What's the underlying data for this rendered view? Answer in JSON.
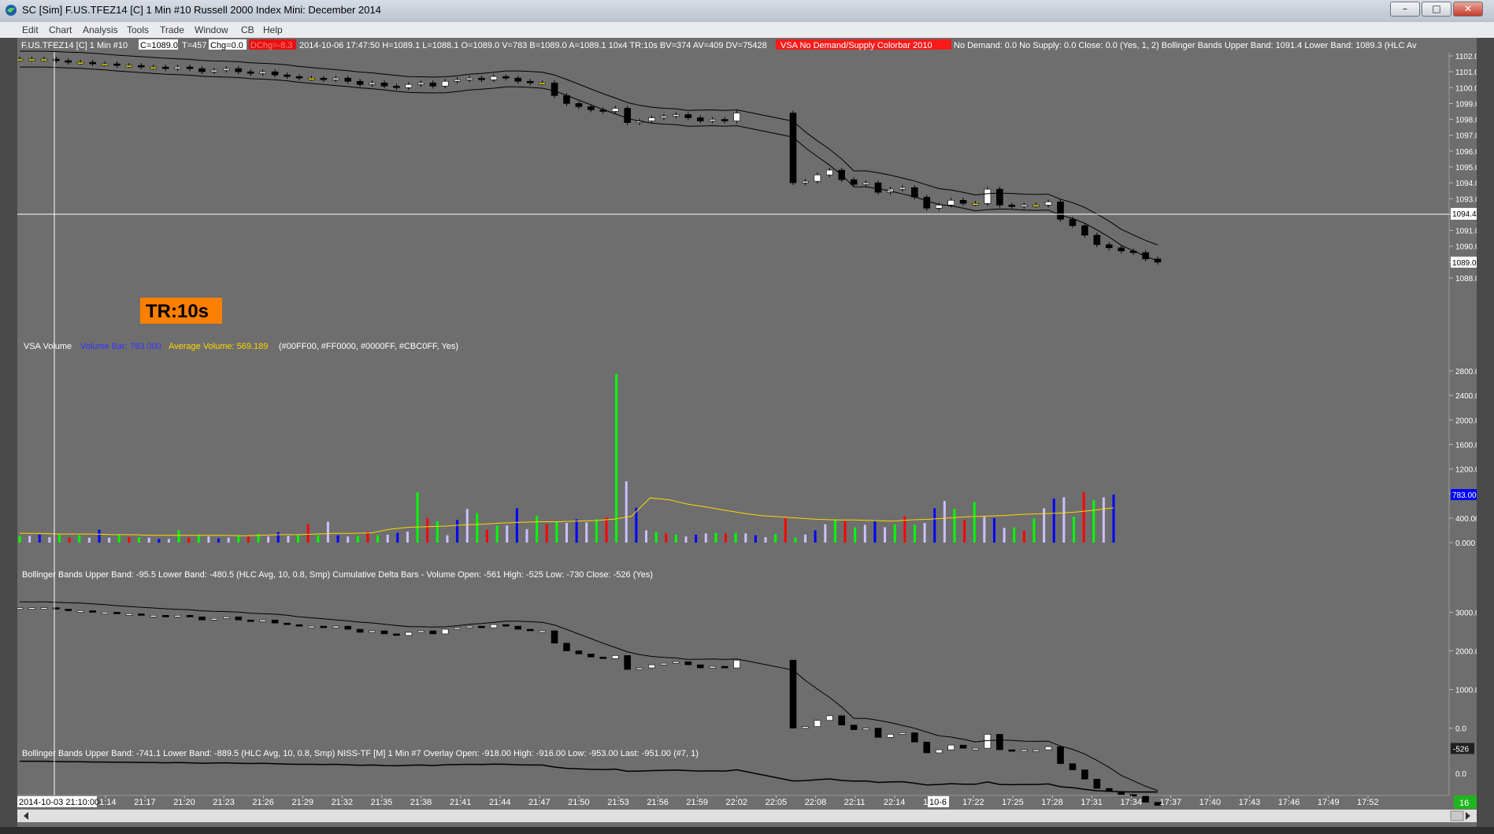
{
  "window": {
    "title": "SC [Sim] F.US.TFEZ14 [C]  1 Min   #10  Russell 2000 Index Mini: December 2014",
    "controls": {
      "minimize": "–",
      "maximize": "□",
      "close": "✕"
    }
  },
  "menu": [
    "Edit",
    "Chart",
    "Analysis",
    "Tools",
    "Trade",
    "Window",
    "CB",
    "Help"
  ],
  "colors": {
    "background": "#6e6e6e",
    "up_bar": "#00FF00",
    "down_bar": "#FF0000",
    "neutral_bar": "#0000FF",
    "low_volume_bar": "#CBC0FF",
    "average_line": "#FFD700",
    "tr_label_bg": "#FF8000",
    "vsa_flag_bg": "#FF0000"
  },
  "header": {
    "symbol": "F.US.TFEZ14 [C]  1 Min   #10",
    "c_box": "C=1089.0",
    "t": "T=457",
    "chg_box": "Chg=0.0",
    "dchg_box": "DChg=-8.3",
    "info": "2014-10-06 17:47:50  H=1089.1  L=1088.1  O=1089.0  V=783  B=1089.0  A=1089.1  10x4  TR:10s  BV=374  AV=409  DV=75428",
    "vsa_flag": "VSA No Demand/Supply Colorbar 2010",
    "vsa_values": "No Demand: 0.0   No Supply: 0.0   Close: 0.0   (Yes, 1, 2)   Bollinger Bands   Upper Band: 1091.4   Lower Band: 1089.3   (HLC Av"
  },
  "tr_label": "TR:10s",
  "crosshair": {
    "price_label": "1094.4",
    "date_label": "2014-10-03  21:10:00"
  },
  "volume_panel": {
    "title": "VSA Volume",
    "volume_bar": "Volume Bar: 783.000",
    "average_volume": "Average Volume: 569.189",
    "params": "(#00FF00, #FF0000, #0000FF, #CBC0FF, Yes)",
    "current_label": "783.000"
  },
  "delta_panel": {
    "legend": "Bollinger Bands   Upper Band: -95.5   Lower Band: -480.5   (HLC Avg, 10, 0.8, Smp)   Cumulative Delta Bars - Volume   Open: -561   High: -525   Low: -730   Close: -526   (Yes)",
    "current_label": "-526"
  },
  "niss_panel": {
    "legend": "Bollinger Bands   Upper Band: -741.1   Lower Band: -889.5   (HLC Avg, 10, 0.8, Smp)   NISS-TF [M]  1 Min   #7 Overlay   Open: -918.00   High: -916.00   Low: -953.00   Last: -951.00   (#7, 1)"
  },
  "time_axis_badge": "10-6",
  "corner_badge": "16",
  "chart_data": [
    {
      "type": "candlestick",
      "title": "Russell 2000 Index Mini: December 2014",
      "ylim": [
        1088.0,
        1102.0
      ],
      "y_ticks": [
        1102.0,
        1101.0,
        1100.0,
        1099.0,
        1098.0,
        1097.0,
        1096.0,
        1095.0,
        1094.0,
        1093.0,
        1092.0,
        1091.0,
        1090.0,
        1089.0,
        1088.0
      ],
      "current_price": 1089.0,
      "x_ticks": [
        "21:14",
        "21:17",
        "21:20",
        "21:23",
        "21:26",
        "21:29",
        "21:32",
        "21:35",
        "21:38",
        "21:41",
        "21:44",
        "21:47",
        "21:50",
        "21:53",
        "21:56",
        "21:59",
        "22:02",
        "22:05",
        "22:08",
        "22:11",
        "22:14",
        "17:19",
        "17:22",
        "17:25",
        "17:28",
        "17:31",
        "17:34",
        "17:37",
        "17:40",
        "17:43",
        "17:46",
        "17:49",
        "17:52"
      ],
      "series": [
        {
          "name": "Price (approx. close by bar)",
          "values": [
            1101.8,
            1101.8,
            1101.8,
            1101.7,
            1101.6,
            1101.6,
            1101.5,
            1101.5,
            1101.4,
            1101.4,
            1101.3,
            1101.3,
            1101.2,
            1101.3,
            1101.2,
            1101.0,
            1101.1,
            1101.2,
            1101.0,
            1100.9,
            1101.0,
            1100.8,
            1100.7,
            1100.6,
            1100.6,
            1100.5,
            1100.6,
            1100.4,
            1100.2,
            1100.3,
            1100.1,
            1100.0,
            1100.2,
            1100.3,
            1100.1,
            1100.4,
            1100.5,
            1100.6,
            1100.5,
            1100.7,
            1100.6,
            1100.4,
            1100.3,
            1100.3,
            1099.5,
            1099.0,
            1098.8,
            1098.6,
            1098.5,
            1098.7,
            1097.8,
            1097.9,
            1098.1,
            1098.2,
            1098.3,
            1098.1,
            1097.9,
            1098.0,
            1097.9,
            1098.4,
            1094.0,
            1094.1,
            1094.5,
            1094.8,
            1094.2,
            1093.9,
            1094.0,
            1093.4,
            1093.6,
            1093.7,
            1093.1,
            1092.4,
            1092.6,
            1092.9,
            1092.7,
            1092.7,
            1093.6,
            1092.6,
            1092.5,
            1092.6,
            1092.6,
            1092.8,
            1091.7,
            1091.3,
            1090.7,
            1090.1,
            1089.9,
            1089.7,
            1089.6,
            1089.2,
            1089.0
          ]
        }
      ]
    },
    {
      "type": "bar",
      "title": "VSA Volume",
      "ylim": [
        0,
        2800
      ],
      "y_ticks": [
        2800,
        2400,
        2000,
        1600,
        1200,
        800,
        400,
        0
      ],
      "series": [
        {
          "name": "Volume Bar",
          "values": [
            110,
            110,
            130,
            90,
            130,
            80,
            120,
            80,
            210,
            80,
            130,
            90,
            90,
            80,
            60,
            60,
            200,
            80,
            130,
            100,
            70,
            80,
            110,
            100,
            140,
            100,
            170,
            110,
            120,
            300,
            120,
            340,
            120,
            100,
            110,
            180,
            120,
            130,
            160,
            180,
            820,
            400,
            350,
            120,
            370,
            550,
            480,
            210,
            280,
            280,
            560,
            220,
            440,
            300,
            340,
            320,
            380,
            330,
            380,
            410,
            2750,
            1000,
            570,
            200,
            170,
            150,
            130,
            100,
            130,
            150,
            160,
            150,
            160,
            150,
            120,
            90,
            140,
            400,
            80,
            130,
            200,
            300,
            380,
            350,
            250,
            290,
            350,
            250,
            300,
            430,
            290,
            320,
            560,
            680,
            550,
            370,
            660,
            420,
            400,
            240,
            250,
            190,
            390,
            560,
            720,
            740,
            420,
            820,
            690,
            740,
            783
          ]
        },
        {
          "name": "Average Volume",
          "values": [
            150,
            150,
            140,
            140,
            140,
            130,
            130,
            120,
            120,
            120,
            120,
            120,
            110,
            120,
            130,
            130,
            140,
            150,
            150,
            160,
            220,
            250,
            260,
            270,
            290,
            300,
            320,
            330,
            340,
            340,
            350,
            360,
            380,
            430,
            730,
            700,
            630,
            580,
            530,
            480,
            440,
            420,
            400,
            380,
            370,
            370,
            360,
            350,
            370,
            380,
            400,
            420,
            430,
            440,
            460,
            470,
            480,
            500,
            530,
            569.189
          ]
        }
      ]
    },
    {
      "type": "candlestick",
      "title": "Cumulative Delta Bars - Volume",
      "ylim": [
        -600,
        3600
      ],
      "y_ticks": [
        3000,
        2000,
        1000,
        0
      ],
      "current_value": -526
    },
    {
      "type": "candlestick",
      "title": "NISS-TF [M]  1 Min   #7 Overlay",
      "y_ticks": [
        0
      ],
      "current_value": -951
    }
  ]
}
